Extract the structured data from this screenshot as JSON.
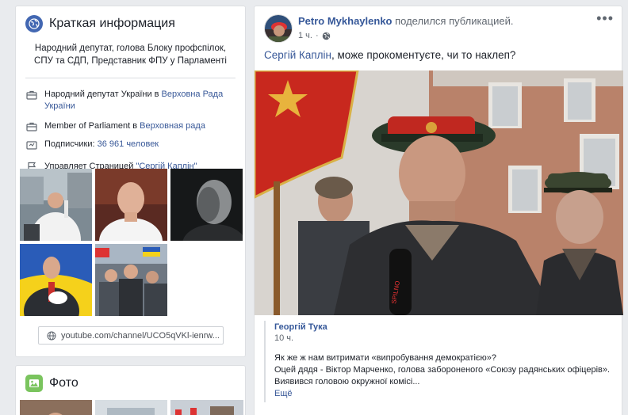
{
  "info": {
    "title": "Краткая информация",
    "summary": "Народний депутат, голова Блоку профспілок, СПУ та СДП, Представник ФПУ у Парламенті",
    "row1_text": "Народний депутат України в ",
    "row1_link": "Верховна Рада України",
    "row2_text": "Member of Parliament в ",
    "row2_link": "Верховная рада",
    "row3_text": "Подписчики: ",
    "row3_link": "36 961 человек",
    "row4_text": "Управляет Страницей ",
    "row4_link": "\"Сергій Каплін\"",
    "youtube": "youtube.com/channel/UCO5qVKl-ienrw..."
  },
  "photos": {
    "title": "Фото"
  },
  "post": {
    "author": "Petro Mykhaylenko",
    "action": " поделился публикацией.",
    "time": "1 ч.",
    "mention": "Сергій Каплін",
    "text": ", може прокоментуєте, чи то наклеп?",
    "more": "•••"
  },
  "quote": {
    "author": "Георгій Тука",
    "time": "10 ч.",
    "line1": "Як же ж нам витримати «випробування демократією»?",
    "line2": "Оцей дядя - Віктор Марченко, голова забороненого «Союзу радянських офіцерів».",
    "line3": "Виявився головою окружної комісі...",
    "more": "Ещё"
  },
  "colors": {
    "brand": "#4267b2",
    "link": "#385898",
    "photo_icon": "#7ac45e"
  }
}
